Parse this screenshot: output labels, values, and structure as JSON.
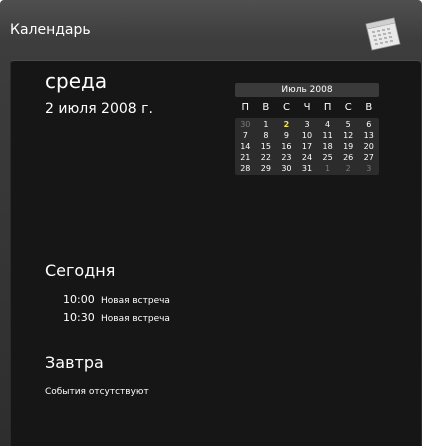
{
  "gadget": {
    "title": "Календарь",
    "icon": "calendar-icon"
  },
  "date": {
    "weekday": "среда",
    "full_date": "2 июля 2008 г."
  },
  "mini_calendar": {
    "month_label": "Июль 2008",
    "weekday_headers": [
      "П",
      "В",
      "С",
      "Ч",
      "П",
      "С",
      "В"
    ],
    "weeks": [
      [
        {
          "d": "30",
          "other": true
        },
        {
          "d": "1"
        },
        {
          "d": "2",
          "today": true
        },
        {
          "d": "3"
        },
        {
          "d": "4"
        },
        {
          "d": "5"
        },
        {
          "d": "6"
        }
      ],
      [
        {
          "d": "7"
        },
        {
          "d": "8"
        },
        {
          "d": "9"
        },
        {
          "d": "10"
        },
        {
          "d": "11"
        },
        {
          "d": "12"
        },
        {
          "d": "13"
        }
      ],
      [
        {
          "d": "14"
        },
        {
          "d": "15"
        },
        {
          "d": "16"
        },
        {
          "d": "17"
        },
        {
          "d": "18"
        },
        {
          "d": "19"
        },
        {
          "d": "20"
        }
      ],
      [
        {
          "d": "21"
        },
        {
          "d": "22"
        },
        {
          "d": "23"
        },
        {
          "d": "24"
        },
        {
          "d": "25"
        },
        {
          "d": "26"
        },
        {
          "d": "27"
        }
      ],
      [
        {
          "d": "28"
        },
        {
          "d": "29"
        },
        {
          "d": "30"
        },
        {
          "d": "31"
        },
        {
          "d": "1",
          "other": true
        },
        {
          "d": "2",
          "other": true
        },
        {
          "d": "3",
          "other": true
        }
      ]
    ],
    "today_color": "#f3e15a"
  },
  "today": {
    "title": "Сегодня",
    "events": [
      {
        "time": "10:00",
        "name": "Новая встреча"
      },
      {
        "time": "10:30",
        "name": "Новая встреча"
      }
    ]
  },
  "tomorrow": {
    "title": "Завтра",
    "empty_text": "События отсутствуют"
  }
}
